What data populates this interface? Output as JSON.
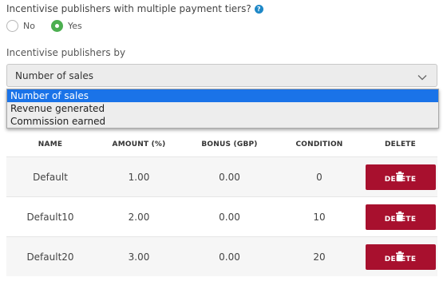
{
  "question": {
    "text": "Incentivise publishers with multiple payment tiers?",
    "help_icon": "?"
  },
  "radios": [
    {
      "label": "No",
      "checked": false
    },
    {
      "label": "Yes",
      "checked": true
    }
  ],
  "incentive": {
    "label": "Incentivise publishers by",
    "selected": "Number of sales",
    "options": [
      "Number of sales",
      "Revenue generated",
      "Commission earned"
    ]
  },
  "table": {
    "headers": [
      "NAME",
      "AMOUNT (%)",
      "BONUS (GBP)",
      "CONDITION",
      "DELETE"
    ],
    "rows": [
      {
        "name": "Default",
        "amount": "1.00",
        "bonus": "0.00",
        "condition": "0",
        "delete_label": "DELETE"
      },
      {
        "name": "Default10",
        "amount": "2.00",
        "bonus": "0.00",
        "condition": "10",
        "delete_label": "DELETE"
      },
      {
        "name": "Default20",
        "amount": "3.00",
        "bonus": "0.00",
        "condition": "20",
        "delete_label": "DELETE"
      }
    ]
  },
  "colors": {
    "accent_green": "#4caf50",
    "delete_red": "#a8102e",
    "selection_blue": "#1a73e8",
    "help_blue": "#1e88c7"
  }
}
